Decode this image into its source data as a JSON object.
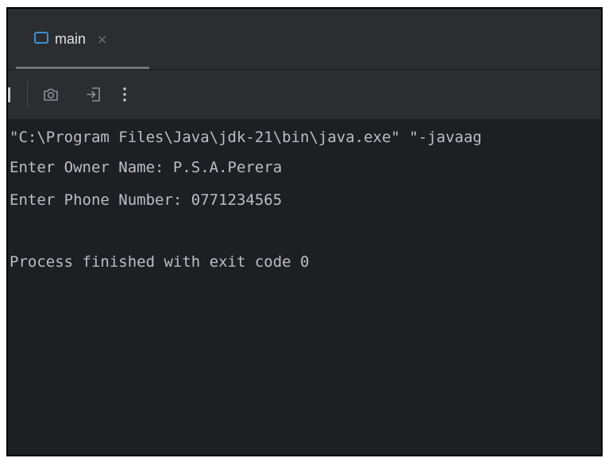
{
  "tab": {
    "label": "main",
    "close_glyph": "×",
    "icon": "console-window-icon"
  },
  "toolbar": {
    "icons": [
      "stop-icon",
      "camera-icon",
      "exit-icon",
      "more-vertical-icon"
    ]
  },
  "console": {
    "lines": [
      "\"C:\\Program Files\\Java\\jdk-21\\bin\\java.exe\" \"-javaag",
      "Enter Owner Name: P.S.A.Perera",
      "Enter Phone Number: 0771234565",
      "",
      "Process finished with exit code 0"
    ]
  },
  "colors": {
    "background": "#1e1f22",
    "panel": "#2b2d30",
    "text": "#bcbec4",
    "tab_icon": "#3e8fd6"
  }
}
